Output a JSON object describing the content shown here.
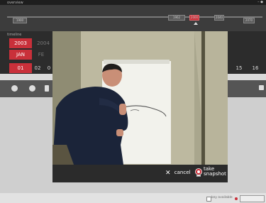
{
  "overview": {
    "title": "overview",
    "controls": "– ◆",
    "markers": [
      "1900",
      "1962",
      "2000",
      "2040",
      "2070"
    ]
  },
  "timeline": {
    "title": "timeline",
    "year_row": [
      "2003",
      "2004"
    ],
    "month_row": [
      "JAN",
      "FE"
    ],
    "day_row": [
      "01",
      "02",
      "0",
      "15",
      "16"
    ]
  },
  "modal": {
    "cancel_label": "cancel",
    "snapshot_label_line1": "take",
    "snapshot_label_line2": "snapshot"
  },
  "footer": {
    "key_label": "key available"
  },
  "colors": {
    "accent": "#c9303a",
    "topbar": "#1e1e1e"
  }
}
